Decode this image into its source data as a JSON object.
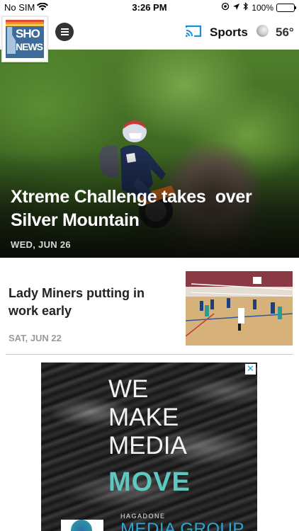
{
  "status_bar": {
    "carrier": "No SIM",
    "time": "3:26 PM",
    "battery": "100%",
    "battery_level": 1.0
  },
  "header": {
    "logo_text_top": "SHO",
    "logo_text_bottom": "NEWS",
    "section": "Sports",
    "temperature": "56°"
  },
  "hero": {
    "title": "Xtreme Challenge takes  over\nSilver Mountain",
    "date": "WED, JUN 26"
  },
  "story": {
    "title": "Lady Miners putting in work early",
    "date": "SAT, JUN 22"
  },
  "ad": {
    "close": "✕",
    "line1": "WE",
    "line2": "MAKE",
    "line3": "MEDIA",
    "line4": "MOVE",
    "brand_small": "HAGADONE",
    "brand_big": "MEDIA GROUP"
  },
  "colors": {
    "cast_accent": "#1a8fe0",
    "ad_move": "#5ec7bf",
    "ad_brand": "#2aa6d6",
    "logo_bg": "#3d6c9a"
  },
  "icons": [
    "wifi-icon",
    "location-icon",
    "bluetooth-icon",
    "cast-icon",
    "menu-icon",
    "moon-icon",
    "close-icon"
  ]
}
